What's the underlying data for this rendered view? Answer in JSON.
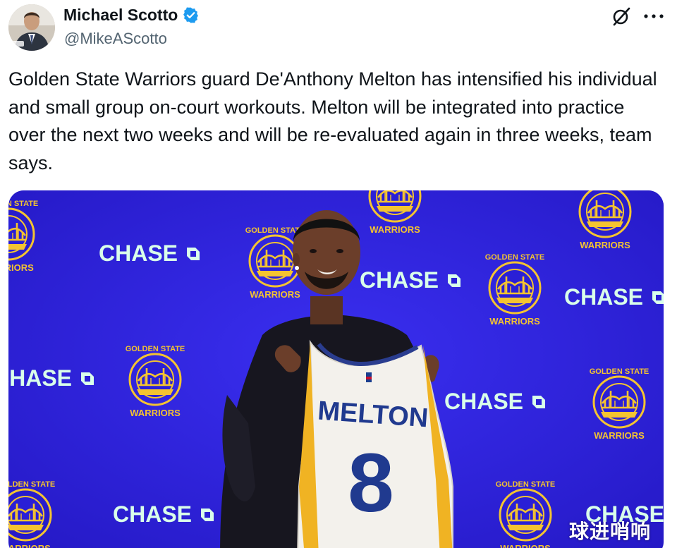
{
  "author": {
    "name": "Michael Scotto",
    "handle": "@MikeAScotto",
    "verified": true,
    "verified_color": "#1d9bf0"
  },
  "header_icons": {
    "grok": "grok-icon",
    "more": "more-icon"
  },
  "tweet": {
    "text": "Golden State Warriors guard De'Anthony Melton has intensified his individual and small group on-court workouts. Melton will be integrated into practice over the next two weeks and will be re-evaluated again in three weeks, team says."
  },
  "media": {
    "backdrop_sponsor": "CHASE",
    "team_logo_top": "GOLDEN STATE",
    "team_logo_bottom": "WARRIORS",
    "jersey_name": "MELTON",
    "jersey_number": "8",
    "watermark": "球进哨响",
    "backdrop_color": "#2a1fd6",
    "logo_color": "#f4c430"
  }
}
